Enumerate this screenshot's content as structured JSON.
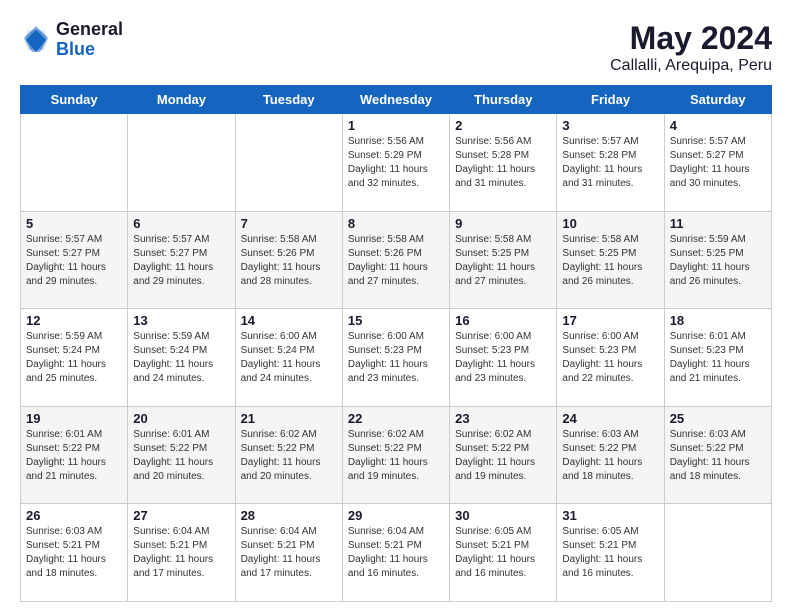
{
  "header": {
    "logo_general": "General",
    "logo_blue": "Blue",
    "title": "May 2024",
    "subtitle": "Callalli, Arequipa, Peru"
  },
  "days_of_week": [
    "Sunday",
    "Monday",
    "Tuesday",
    "Wednesday",
    "Thursday",
    "Friday",
    "Saturday"
  ],
  "weeks": [
    {
      "row_class": "",
      "days": [
        {
          "number": "",
          "info": ""
        },
        {
          "number": "",
          "info": ""
        },
        {
          "number": "",
          "info": ""
        },
        {
          "number": "1",
          "info": "Sunrise: 5:56 AM\nSunset: 5:29 PM\nDaylight: 11 hours\nand 32 minutes."
        },
        {
          "number": "2",
          "info": "Sunrise: 5:56 AM\nSunset: 5:28 PM\nDaylight: 11 hours\nand 31 minutes."
        },
        {
          "number": "3",
          "info": "Sunrise: 5:57 AM\nSunset: 5:28 PM\nDaylight: 11 hours\nand 31 minutes."
        },
        {
          "number": "4",
          "info": "Sunrise: 5:57 AM\nSunset: 5:27 PM\nDaylight: 11 hours\nand 30 minutes."
        }
      ]
    },
    {
      "row_class": "alt-row",
      "days": [
        {
          "number": "5",
          "info": "Sunrise: 5:57 AM\nSunset: 5:27 PM\nDaylight: 11 hours\nand 29 minutes."
        },
        {
          "number": "6",
          "info": "Sunrise: 5:57 AM\nSunset: 5:27 PM\nDaylight: 11 hours\nand 29 minutes."
        },
        {
          "number": "7",
          "info": "Sunrise: 5:58 AM\nSunset: 5:26 PM\nDaylight: 11 hours\nand 28 minutes."
        },
        {
          "number": "8",
          "info": "Sunrise: 5:58 AM\nSunset: 5:26 PM\nDaylight: 11 hours\nand 27 minutes."
        },
        {
          "number": "9",
          "info": "Sunrise: 5:58 AM\nSunset: 5:25 PM\nDaylight: 11 hours\nand 27 minutes."
        },
        {
          "number": "10",
          "info": "Sunrise: 5:58 AM\nSunset: 5:25 PM\nDaylight: 11 hours\nand 26 minutes."
        },
        {
          "number": "11",
          "info": "Sunrise: 5:59 AM\nSunset: 5:25 PM\nDaylight: 11 hours\nand 26 minutes."
        }
      ]
    },
    {
      "row_class": "",
      "days": [
        {
          "number": "12",
          "info": "Sunrise: 5:59 AM\nSunset: 5:24 PM\nDaylight: 11 hours\nand 25 minutes."
        },
        {
          "number": "13",
          "info": "Sunrise: 5:59 AM\nSunset: 5:24 PM\nDaylight: 11 hours\nand 24 minutes."
        },
        {
          "number": "14",
          "info": "Sunrise: 6:00 AM\nSunset: 5:24 PM\nDaylight: 11 hours\nand 24 minutes."
        },
        {
          "number": "15",
          "info": "Sunrise: 6:00 AM\nSunset: 5:23 PM\nDaylight: 11 hours\nand 23 minutes."
        },
        {
          "number": "16",
          "info": "Sunrise: 6:00 AM\nSunset: 5:23 PM\nDaylight: 11 hours\nand 23 minutes."
        },
        {
          "number": "17",
          "info": "Sunrise: 6:00 AM\nSunset: 5:23 PM\nDaylight: 11 hours\nand 22 minutes."
        },
        {
          "number": "18",
          "info": "Sunrise: 6:01 AM\nSunset: 5:23 PM\nDaylight: 11 hours\nand 21 minutes."
        }
      ]
    },
    {
      "row_class": "alt-row",
      "days": [
        {
          "number": "19",
          "info": "Sunrise: 6:01 AM\nSunset: 5:22 PM\nDaylight: 11 hours\nand 21 minutes."
        },
        {
          "number": "20",
          "info": "Sunrise: 6:01 AM\nSunset: 5:22 PM\nDaylight: 11 hours\nand 20 minutes."
        },
        {
          "number": "21",
          "info": "Sunrise: 6:02 AM\nSunset: 5:22 PM\nDaylight: 11 hours\nand 20 minutes."
        },
        {
          "number": "22",
          "info": "Sunrise: 6:02 AM\nSunset: 5:22 PM\nDaylight: 11 hours\nand 19 minutes."
        },
        {
          "number": "23",
          "info": "Sunrise: 6:02 AM\nSunset: 5:22 PM\nDaylight: 11 hours\nand 19 minutes."
        },
        {
          "number": "24",
          "info": "Sunrise: 6:03 AM\nSunset: 5:22 PM\nDaylight: 11 hours\nand 18 minutes."
        },
        {
          "number": "25",
          "info": "Sunrise: 6:03 AM\nSunset: 5:22 PM\nDaylight: 11 hours\nand 18 minutes."
        }
      ]
    },
    {
      "row_class": "",
      "days": [
        {
          "number": "26",
          "info": "Sunrise: 6:03 AM\nSunset: 5:21 PM\nDaylight: 11 hours\nand 18 minutes."
        },
        {
          "number": "27",
          "info": "Sunrise: 6:04 AM\nSunset: 5:21 PM\nDaylight: 11 hours\nand 17 minutes."
        },
        {
          "number": "28",
          "info": "Sunrise: 6:04 AM\nSunset: 5:21 PM\nDaylight: 11 hours\nand 17 minutes."
        },
        {
          "number": "29",
          "info": "Sunrise: 6:04 AM\nSunset: 5:21 PM\nDaylight: 11 hours\nand 16 minutes."
        },
        {
          "number": "30",
          "info": "Sunrise: 6:05 AM\nSunset: 5:21 PM\nDaylight: 11 hours\nand 16 minutes."
        },
        {
          "number": "31",
          "info": "Sunrise: 6:05 AM\nSunset: 5:21 PM\nDaylight: 11 hours\nand 16 minutes."
        },
        {
          "number": "",
          "info": ""
        }
      ]
    }
  ]
}
